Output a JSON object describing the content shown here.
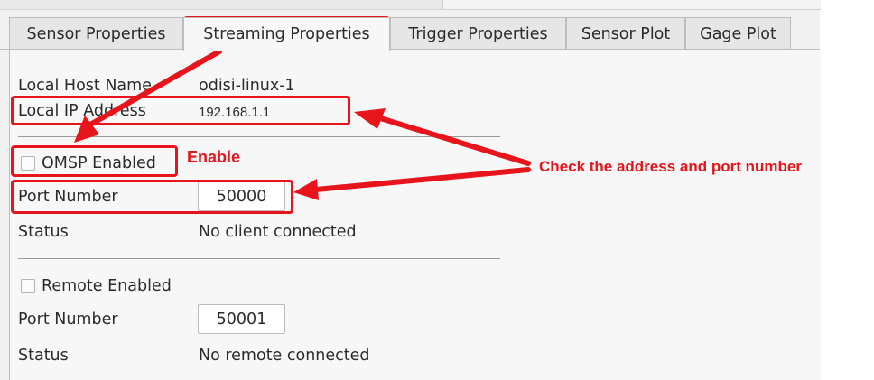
{
  "tabs": [
    {
      "label": "Sensor Properties",
      "active": false
    },
    {
      "label": "Streaming Properties",
      "active": true
    },
    {
      "label": "Trigger Properties",
      "active": false
    },
    {
      "label": "Sensor Plot",
      "active": false
    },
    {
      "label": "Gage Plot",
      "active": false
    }
  ],
  "host": {
    "name_label": "Local Host Name",
    "name_value": "odisi-linux-1",
    "ip_label": "Local IP Address",
    "ip_value": "192.168.1.1"
  },
  "omsp": {
    "enabled_label": "OMSP Enabled",
    "enabled": false,
    "port_label": "Port Number",
    "port_value": "50000",
    "status_label": "Status",
    "status_value": "No client connected"
  },
  "remote": {
    "enabled_label": "Remote Enabled",
    "enabled": false,
    "port_label": "Port Number",
    "port_value": "50001",
    "status_label": "Status",
    "status_value": "No remote connected"
  },
  "annotations": {
    "enable": "Enable",
    "check": "Check the address and port number",
    "color": "#e8141c"
  }
}
